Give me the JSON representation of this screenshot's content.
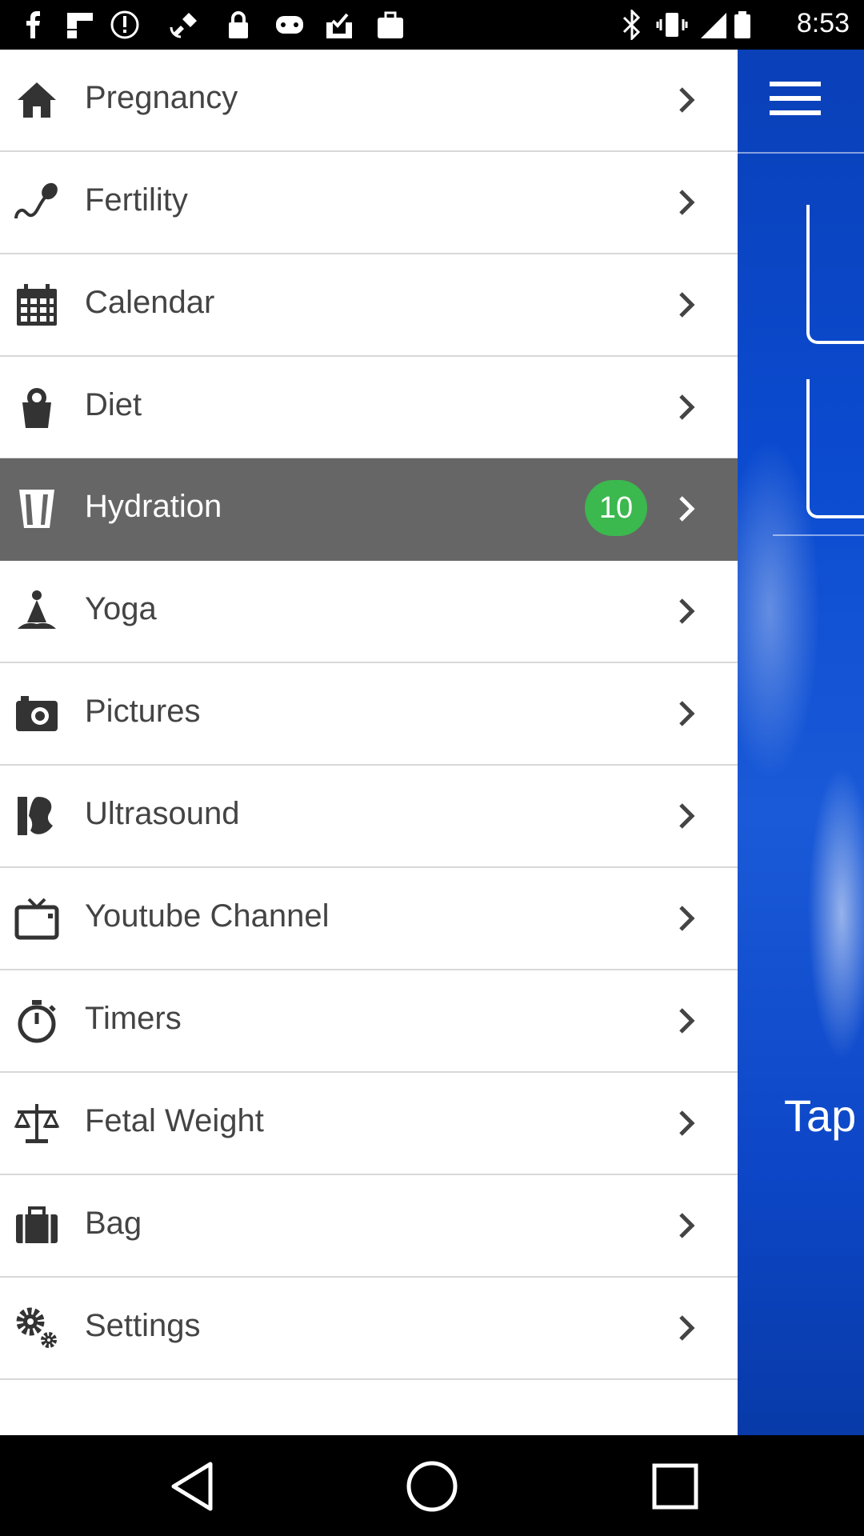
{
  "status_bar": {
    "time": "8:53",
    "left_icons": [
      "facebook-icon",
      "flipboard-icon",
      "alert-icon",
      "fake-gps-icon",
      "lock-icon",
      "game-controller-icon",
      "download-check-icon",
      "briefcase-icon"
    ],
    "right_icons": [
      "bluetooth-icon",
      "vibrate-icon",
      "signal-icon",
      "battery-icon"
    ]
  },
  "drawer": {
    "items": [
      {
        "label": "Pregnancy",
        "icon": "home-icon"
      },
      {
        "label": "Fertility",
        "icon": "sperm-icon"
      },
      {
        "label": "Calendar",
        "icon": "calendar-icon"
      },
      {
        "label": "Diet",
        "icon": "apple-icon"
      },
      {
        "label": "Hydration",
        "icon": "glass-icon",
        "badge": "10",
        "active": true
      },
      {
        "label": "Yoga",
        "icon": "yoga-icon"
      },
      {
        "label": "Pictures",
        "icon": "camera-icon"
      },
      {
        "label": "Ultrasound",
        "icon": "ultrasound-icon"
      },
      {
        "label": "Youtube Channel",
        "icon": "tv-icon"
      },
      {
        "label": "Timers",
        "icon": "stopwatch-icon"
      },
      {
        "label": "Fetal Weight",
        "icon": "scale-icon"
      },
      {
        "label": "Bag",
        "icon": "bag-icon"
      },
      {
        "label": "Settings",
        "icon": "gears-icon"
      }
    ]
  },
  "background": {
    "partial_text": "Tap",
    "menu_icon": "hamburger-menu-icon",
    "accent_color": "#0b4bd0"
  },
  "colors": {
    "active_row": "#666666",
    "badge": "#3bb84e"
  },
  "nav_bar": {
    "buttons": [
      "back-icon",
      "home-circle-icon",
      "recents-icon"
    ]
  }
}
